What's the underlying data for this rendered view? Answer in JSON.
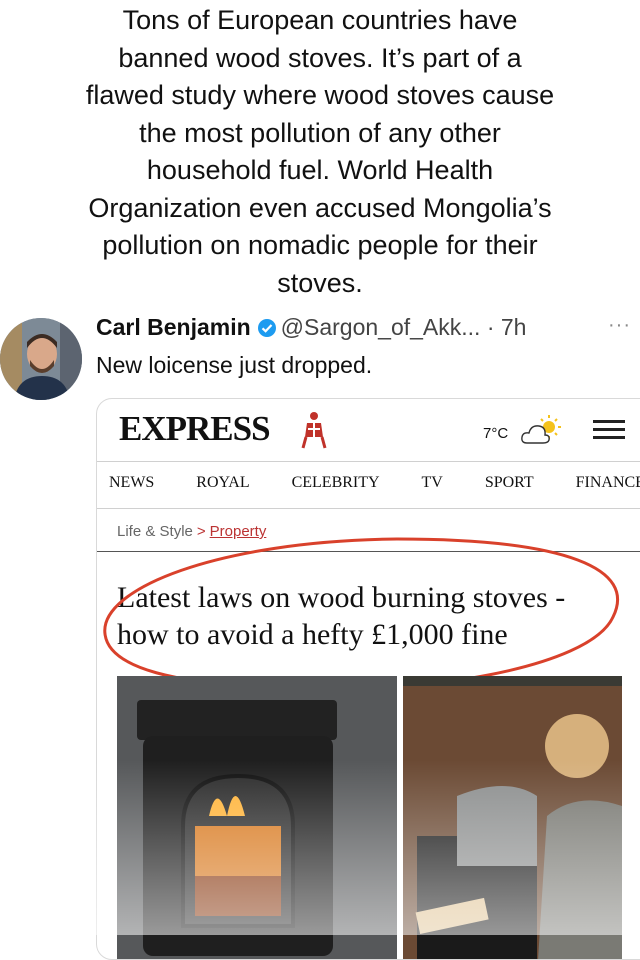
{
  "caption": {
    "lines": [
      "Tons of European countries have",
      "banned wood stoves. It’s part of a",
      "flawed study where wood stoves cause",
      "the most pollution of any other",
      "household fuel. World Health",
      "Organization even accused Mongolia’s",
      "pollution on nomadic people for their",
      "stoves."
    ]
  },
  "tweet": {
    "author_name": "Carl Benjamin",
    "handle": "@Sargon_of_Akk...",
    "time": "· 7h",
    "more": "···",
    "text": "New loicense just dropped.",
    "verified_color": "#1d9bf0"
  },
  "article": {
    "logo": "EXPRESS",
    "temperature": "7°C",
    "nav": [
      "NEWS",
      "ROYAL",
      "CELEBRITY",
      "TV",
      "SPORT",
      "FINANCE"
    ],
    "breadcrumb": [
      "Life & Style",
      "Property"
    ],
    "breadcrumb_sep": ">",
    "headline_lines": [
      "Latest laws on wood burning stoves -",
      "how to avoid a hefty £1,000 fine"
    ],
    "accent_color": "#d9412b"
  }
}
